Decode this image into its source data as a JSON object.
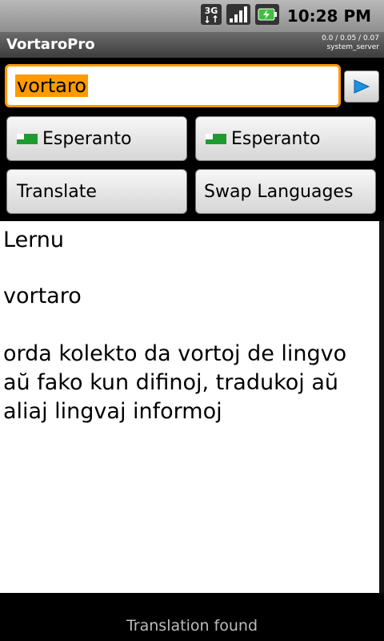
{
  "status_bar": {
    "network_type": "3G",
    "time": "10:28 PM"
  },
  "title_bar": {
    "app_title": "VortaroPro",
    "load_line1": "0.0 / 0.05 / 0.07",
    "load_line2": "system_server"
  },
  "search": {
    "value": "vortaro"
  },
  "languages": {
    "from_label": "Esperanto",
    "to_label": "Esperanto"
  },
  "actions": {
    "translate_label": "Translate",
    "swap_label": "Swap Languages"
  },
  "result": {
    "source": "Lernu",
    "word": "vortaro",
    "definition": "orda kolekto da vortoj de lingvo aŭ fako kun difinoj, tradukoj aŭ aliaj lingvaj informoj"
  },
  "footer": {
    "status_message": "Translation found"
  },
  "colors": {
    "focus_orange": "#ff9a00",
    "flag_green": "#1e9b2e",
    "go_arrow_blue": "#1e90e0"
  }
}
